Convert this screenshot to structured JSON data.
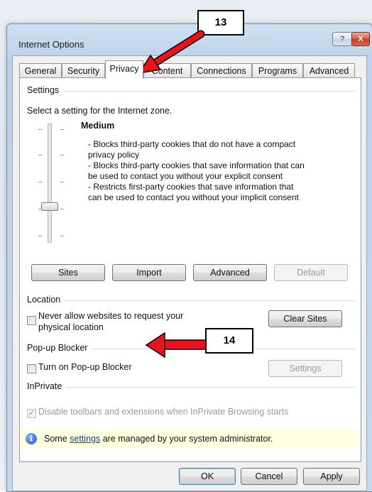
{
  "window": {
    "title": "Internet Options",
    "help_label": "?",
    "close_label": "X"
  },
  "tabs": [
    {
      "label": "General"
    },
    {
      "label": "Security"
    },
    {
      "label": "Privacy"
    },
    {
      "label": "Content"
    },
    {
      "label": "Connections"
    },
    {
      "label": "Programs"
    },
    {
      "label": "Advanced"
    }
  ],
  "settings": {
    "group_label": "Settings",
    "instruction": "Select a setting for the Internet zone.",
    "level": "Medium",
    "description_lines": [
      "- Blocks third-party cookies that do not have a compact",
      "privacy policy",
      "- Blocks third-party cookies that save information that can",
      "be used to contact you without your explicit consent",
      "- Restricts first-party cookies that save information that",
      "can be used to contact you without your implicit consent"
    ],
    "buttons": {
      "sites": "Sites",
      "import": "Import",
      "advanced": "Advanced",
      "default": "Default"
    }
  },
  "location": {
    "group_label": "Location",
    "checkbox_line1": "Never allow websites to request your",
    "checkbox_line2": "physical location",
    "clear_sites": "Clear Sites"
  },
  "popup": {
    "group_label": "Pop-up Blocker",
    "checkbox_label": "Turn on Pop-up Blocker",
    "settings_button": "Settings"
  },
  "inprivate": {
    "group_label": "InPrivate",
    "checkbox_label": "Disable toolbars and extensions when InPrivate Browsing starts",
    "check_mark": "✓"
  },
  "infobar": {
    "icon": "i",
    "text_before": "Some ",
    "link": "settings",
    "text_after": " are managed by your system administrator."
  },
  "footer": {
    "ok": "OK",
    "cancel": "Cancel",
    "apply": "Apply"
  },
  "callouts": {
    "step13": "13",
    "step14": "14"
  },
  "colors": {
    "arrow": "#e8141a",
    "infobar": "#ffffe1",
    "link": "#0645ad"
  }
}
